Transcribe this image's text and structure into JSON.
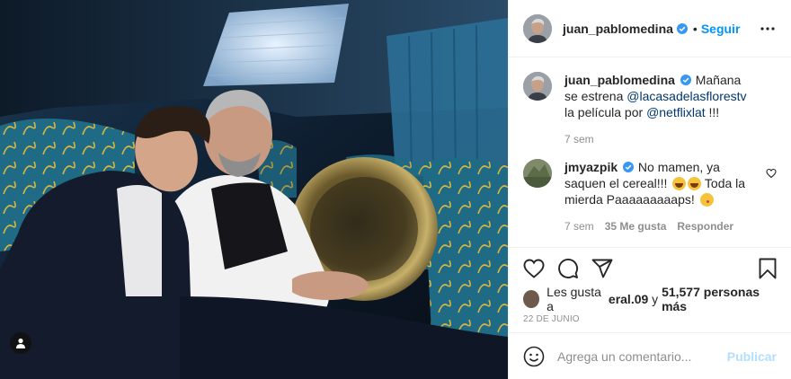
{
  "post": {
    "author": "juan_pablomedina",
    "follow_label": "Seguir",
    "separator": "•",
    "verified_icon": "verified-badge-icon",
    "more_icon": "more-options-icon"
  },
  "caption": {
    "author": "juan_pablomedina",
    "text_before": "Mañana se estrena ",
    "mention1": "@lacasadelasflorestv",
    "text_middle": " la película por ",
    "mention2": "@netflixlat",
    "text_after": " !!!",
    "time": "7 sem"
  },
  "comment": {
    "author": "jmyazpik",
    "text": "No mamen, ya saquen el cereal!!!",
    "text_after": " Toda la mierda Paaaaaaaaaps!",
    "time": "7 sem",
    "likes": "35 Me gusta",
    "reply_label": "Responder"
  },
  "likes": {
    "prefix": "Les gusta a ",
    "first_user": "eral.09",
    "middle": " y ",
    "count": "51,577 personas más"
  },
  "date": "22 DE JUNIO",
  "add_comment": {
    "placeholder": "Agrega un comentario...",
    "publish_label": "Publicar"
  },
  "colors": {
    "accent": "#0095f6",
    "link": "#00376b",
    "muted": "#8e8e8e",
    "border": "#efefef"
  }
}
